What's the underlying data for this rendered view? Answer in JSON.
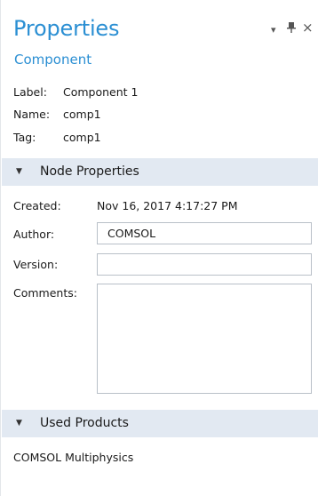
{
  "header": {
    "title": "Properties",
    "subtitle": "Component",
    "controls": {
      "menu_icon": "▾",
      "pin_icon": "⊥",
      "close_icon": "×"
    }
  },
  "identity": {
    "label_key": "Label:",
    "label_value": "Component 1",
    "name_key": "Name:",
    "name_value": "comp1",
    "tag_key": "Tag:",
    "tag_value": "comp1"
  },
  "node_properties": {
    "section_label": "Node Properties",
    "created_label": "Created:",
    "created_value": "Nov 16, 2017 4:17:27 PM",
    "author_label": "Author:",
    "author_value": "COMSOL",
    "version_label": "Version:",
    "version_value": "",
    "comments_label": "Comments:",
    "comments_value": ""
  },
  "used_products": {
    "section_label": "Used Products",
    "items": [
      "COMSOL Multiphysics"
    ]
  },
  "colors": {
    "accent": "#2b8fd3",
    "section_bg": "#e2e9f2"
  }
}
